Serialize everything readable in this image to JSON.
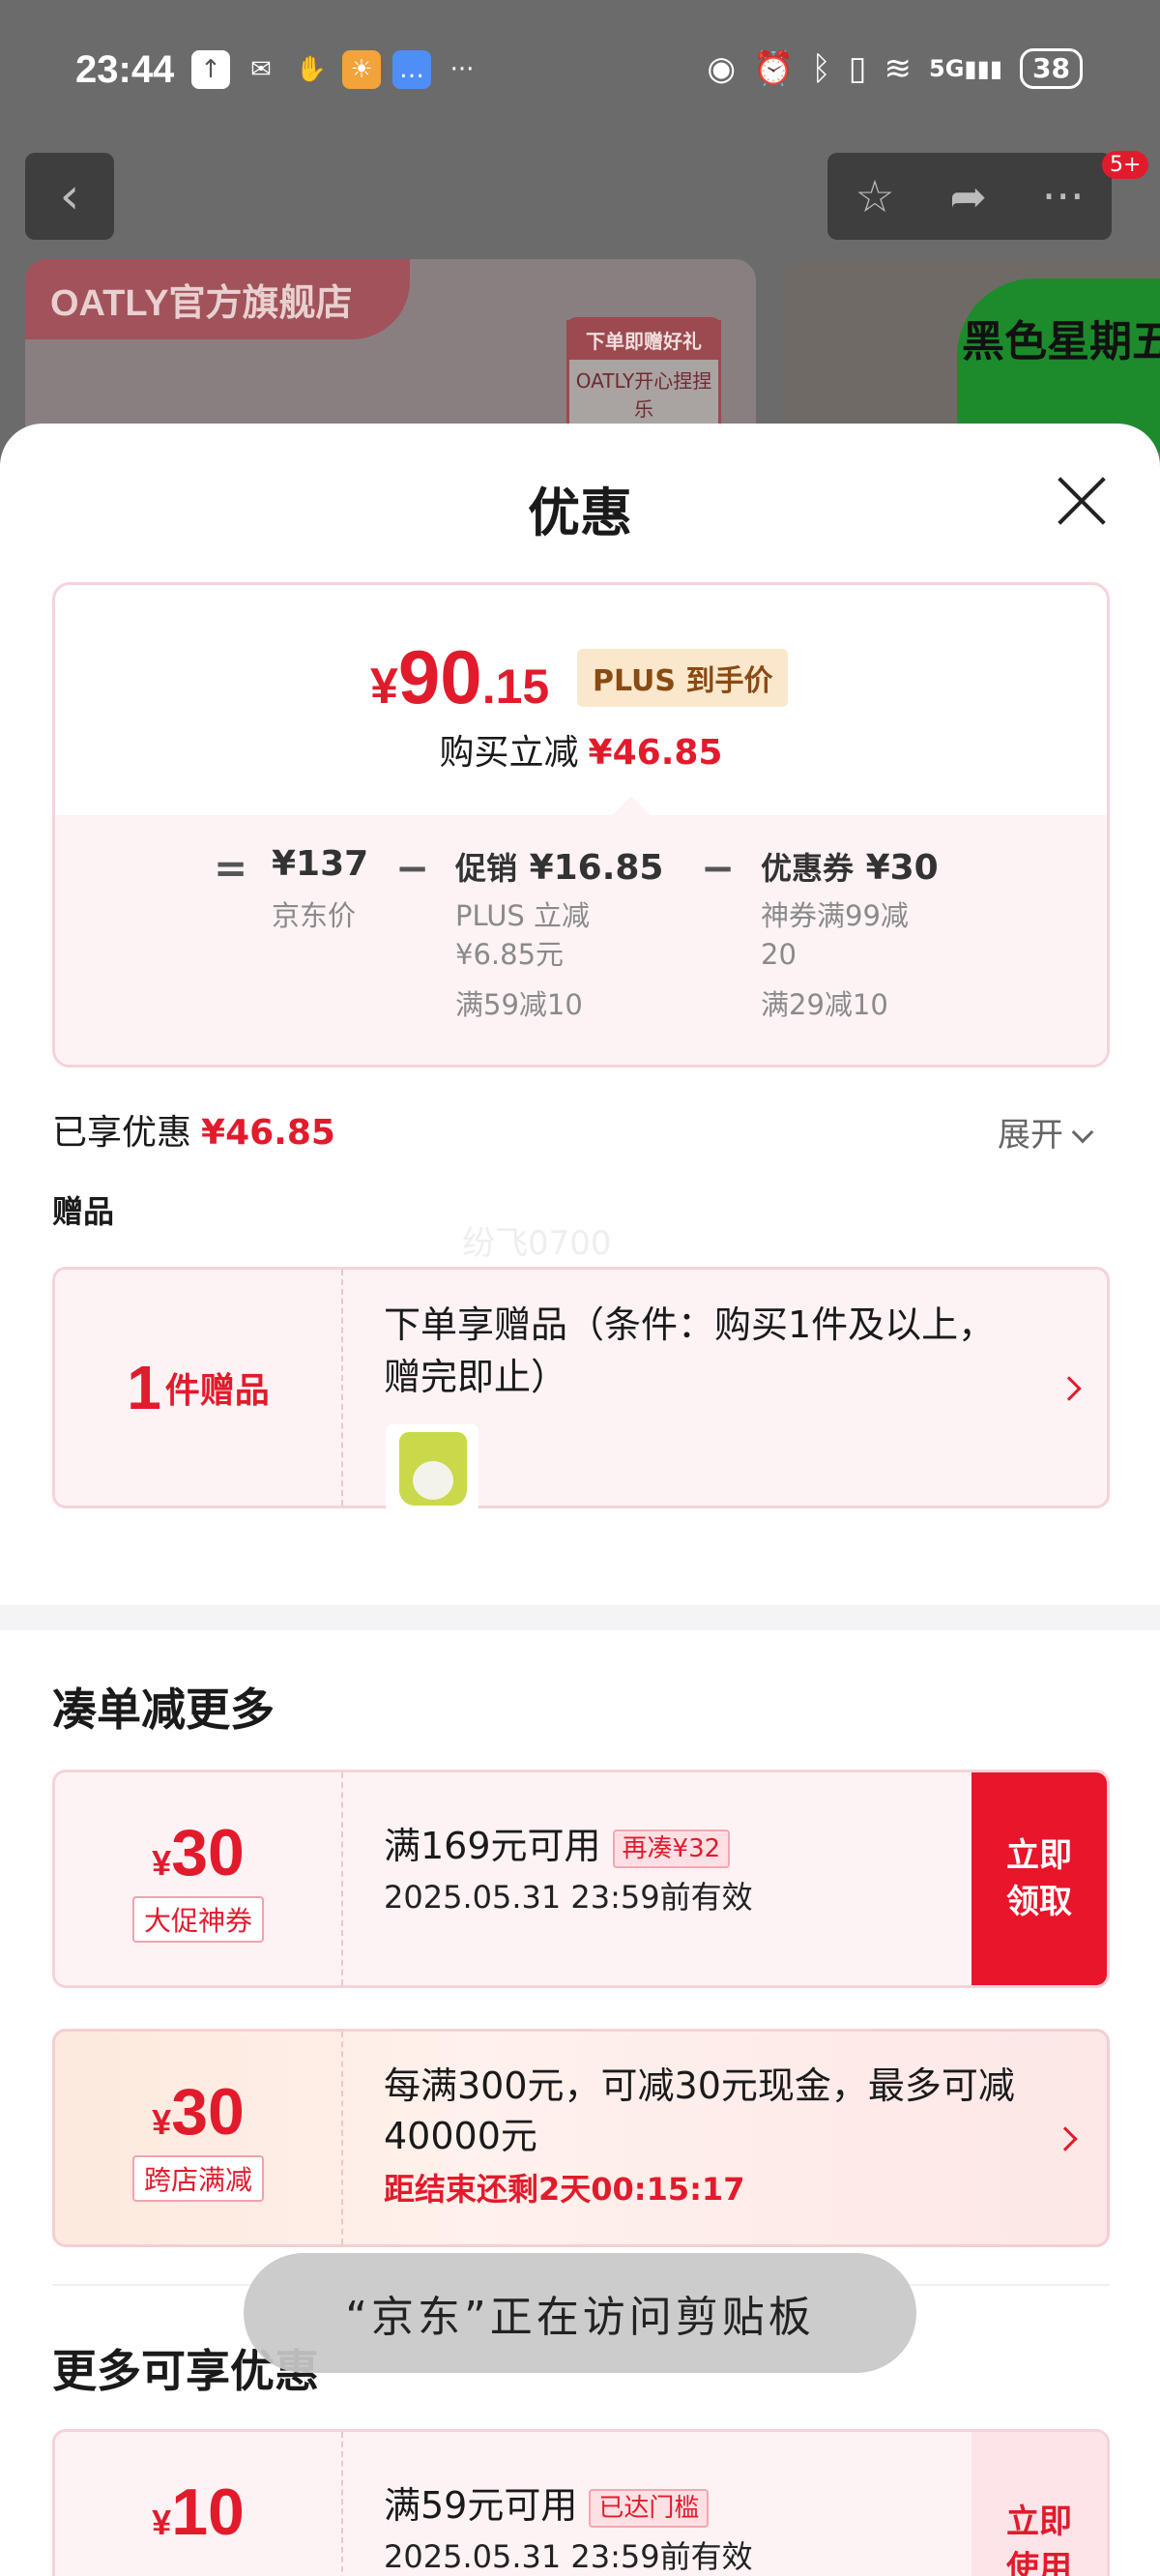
{
  "status_bar": {
    "time": "23:44",
    "network": "5G",
    "battery": "38"
  },
  "background_page": {
    "cart_badge": "5+",
    "store_name": "OATLY官方旗舰店",
    "gift_banner_title": "下单即赠好礼",
    "gift_banner_sub": "OATLY开心捏捏乐",
    "promo_banner": "黑色星期五"
  },
  "sheet": {
    "title": "优惠",
    "price_card": {
      "currency": "¥",
      "final_int": "90",
      "final_dec": ".15",
      "plus_tag": "PLUS 到手价",
      "instant_label": "购买立减",
      "instant_amount": "¥46.85",
      "eq": "=",
      "minus": "−",
      "jd_price": "¥137",
      "jd_price_label": "京东价",
      "promo_label": "促销",
      "promo_amount": "¥16.85",
      "promo_line1": "PLUS 立减",
      "promo_line2": "¥6.85元",
      "promo_line3": "满59减10",
      "coupon_label": "优惠券",
      "coupon_amount": "¥30",
      "coupon_line1": "神券满99减",
      "coupon_line2": "20",
      "coupon_line3": "满29减10"
    },
    "enjoyed_label": "已享优惠",
    "enjoyed_amount": "¥46.85",
    "expand_label": "展开",
    "gift_section_title": "赠品",
    "watermark": "纷飞0700",
    "gift_card": {
      "count": "1",
      "count_unit": "件赠品",
      "description": "下单享赠品（条件：购买1件及以上，赠完即止）"
    },
    "section_more_title": "凑单减更多",
    "coupons": [
      {
        "symbol": "¥",
        "amount": "30",
        "tag": "大促神券",
        "condition": "满169元可用",
        "chip": "再凑¥32",
        "date": "2025.05.31 23:59前有效",
        "button": "立即领取"
      },
      {
        "symbol": "¥",
        "amount": "30",
        "tag": "跨店满减",
        "condition": "每满300元，可减30元现金，最多可减40000元",
        "countdown": "距结束还剩2天00:15:17"
      }
    ],
    "section_available_title": "更多可享优惠",
    "available_coupon": {
      "symbol": "¥",
      "amount": "10",
      "condition": "满59元可用",
      "chip": "已达门槛",
      "date": "2025.05.31 23:59前有效",
      "button": "立即使用"
    },
    "toast": "“京东”正在访问剪贴板"
  },
  "colors": {
    "accent_red": "#e21b2c",
    "card_border": "#f6d3d8",
    "card_bg": "#fdf3f5",
    "plus_tag_bg": "#fbe8cc"
  }
}
